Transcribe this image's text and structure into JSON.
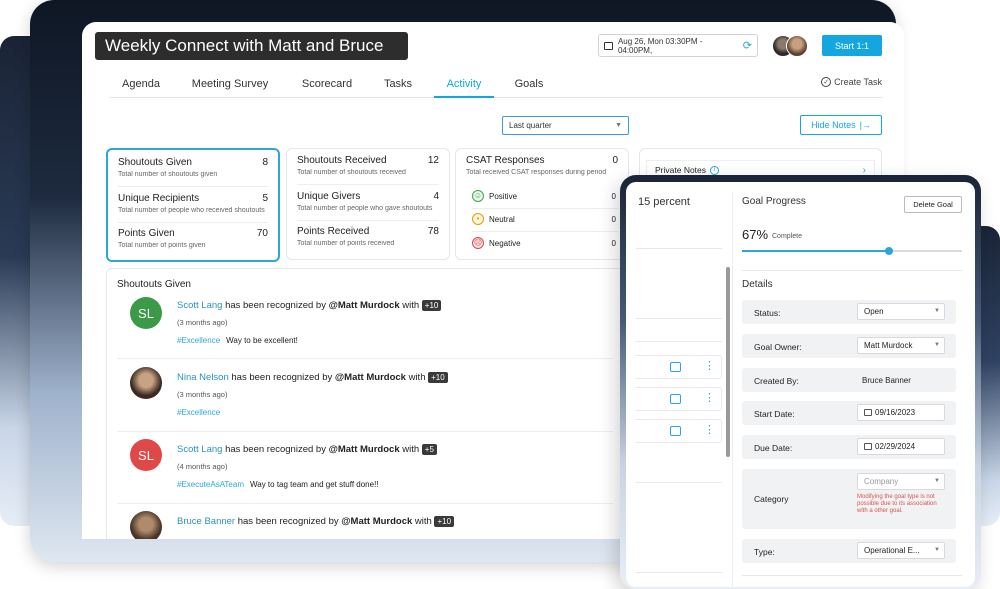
{
  "header": {
    "title": "Weekly Connect with Matt and Bruce",
    "date": "Aug 26, Mon  03:30PM - 04:00PM,",
    "start_button": "Start 1:1"
  },
  "tabs": [
    {
      "label": "Agenda"
    },
    {
      "label": "Meeting Survey"
    },
    {
      "label": "Scorecard"
    },
    {
      "label": "Tasks"
    },
    {
      "label": "Activity",
      "active": true
    },
    {
      "label": "Goals"
    }
  ],
  "create_task": "Create Task",
  "filter": {
    "selected": "Last quarter"
  },
  "hide_notes": "Hide Notes",
  "metrics": {
    "given": [
      {
        "title": "Shoutouts Given",
        "value": "8",
        "desc": "Total number of shoutouts given"
      },
      {
        "title": "Unique Recipients",
        "value": "5",
        "desc": "Total number of people who received shoutouts"
      },
      {
        "title": "Points Given",
        "value": "70",
        "desc": "Total number of points given"
      }
    ],
    "received": [
      {
        "title": "Shoutouts Received",
        "value": "12",
        "desc": "Total number of shoutouts received"
      },
      {
        "title": "Unique Givers",
        "value": "4",
        "desc": "Total number of people who gave shoutouts"
      },
      {
        "title": "Points Received",
        "value": "78",
        "desc": "Total number of points received"
      }
    ],
    "csat": {
      "title": "CSAT Responses",
      "value": "0",
      "desc": "Total received CSAT responses during period",
      "rows": [
        {
          "label": "Positive",
          "value": "0"
        },
        {
          "label": "Neutral",
          "value": "0"
        },
        {
          "label": "Negative",
          "value": "0"
        }
      ]
    }
  },
  "feed": {
    "title": "Shoutouts Given",
    "items": [
      {
        "initials": "SL",
        "color": "#3a9a48",
        "name": "Scott Lang",
        "mid": "has been recognized by",
        "by": "@Matt Murdock",
        "with": "with",
        "points": "+10",
        "time": "(3 months ago)",
        "tag": "#Excellence",
        "message": "Way to be excellent!"
      },
      {
        "initials": "",
        "color": "#444444",
        "name": "Nina Nelson",
        "mid": "has been recognized by",
        "by": "@Matt Murdock",
        "with": "with",
        "points": "+10",
        "time": "(3 months ago)",
        "tag": "#Excellence",
        "message": ""
      },
      {
        "initials": "SL",
        "color": "#e04848",
        "name": "Scott Lang",
        "mid": "has been recognized by",
        "by": "@Matt Murdock",
        "with": "with",
        "points": "+5",
        "time": "(4 months ago)",
        "tag": "#ExecuteAsATeam",
        "message": "Way to tag team and get stuff done!!"
      },
      {
        "initials": "",
        "color": "#7a5a40",
        "name": "Bruce Banner",
        "mid": "has been recognized by",
        "by": "@Matt Murdock",
        "with": "with",
        "points": "+10",
        "time": "",
        "tag": "",
        "message": ""
      }
    ]
  },
  "notes": {
    "title": "Private Notes"
  },
  "goal_panel": {
    "left_value": "15 percent",
    "title": "Goal Progress",
    "delete_button": "Delete Goal",
    "progress_text": "67%",
    "progress_label": "Complete",
    "progress": 0.67,
    "details_title": "Details",
    "status": {
      "label": "Status:",
      "value": "Open"
    },
    "owner": {
      "label": "Goal Owner:",
      "value": "Matt Murdock"
    },
    "created_by": {
      "label": "Created By:",
      "value": "Bruce Banner"
    },
    "start_date": {
      "label": "Start Date:",
      "value": "09/16/2023"
    },
    "due_date": {
      "label": "Due Date:",
      "value": "02/29/2024"
    },
    "category": {
      "label": "Category",
      "value": "Company",
      "warning": "Modifying the goal type is not possible due to its association with a other goal."
    },
    "type": {
      "label": "Type:",
      "value": "Operational E..."
    }
  },
  "colors": {
    "accent": "#14a6df",
    "tag": "#2aa7d8",
    "warning": "#d9534f"
  }
}
